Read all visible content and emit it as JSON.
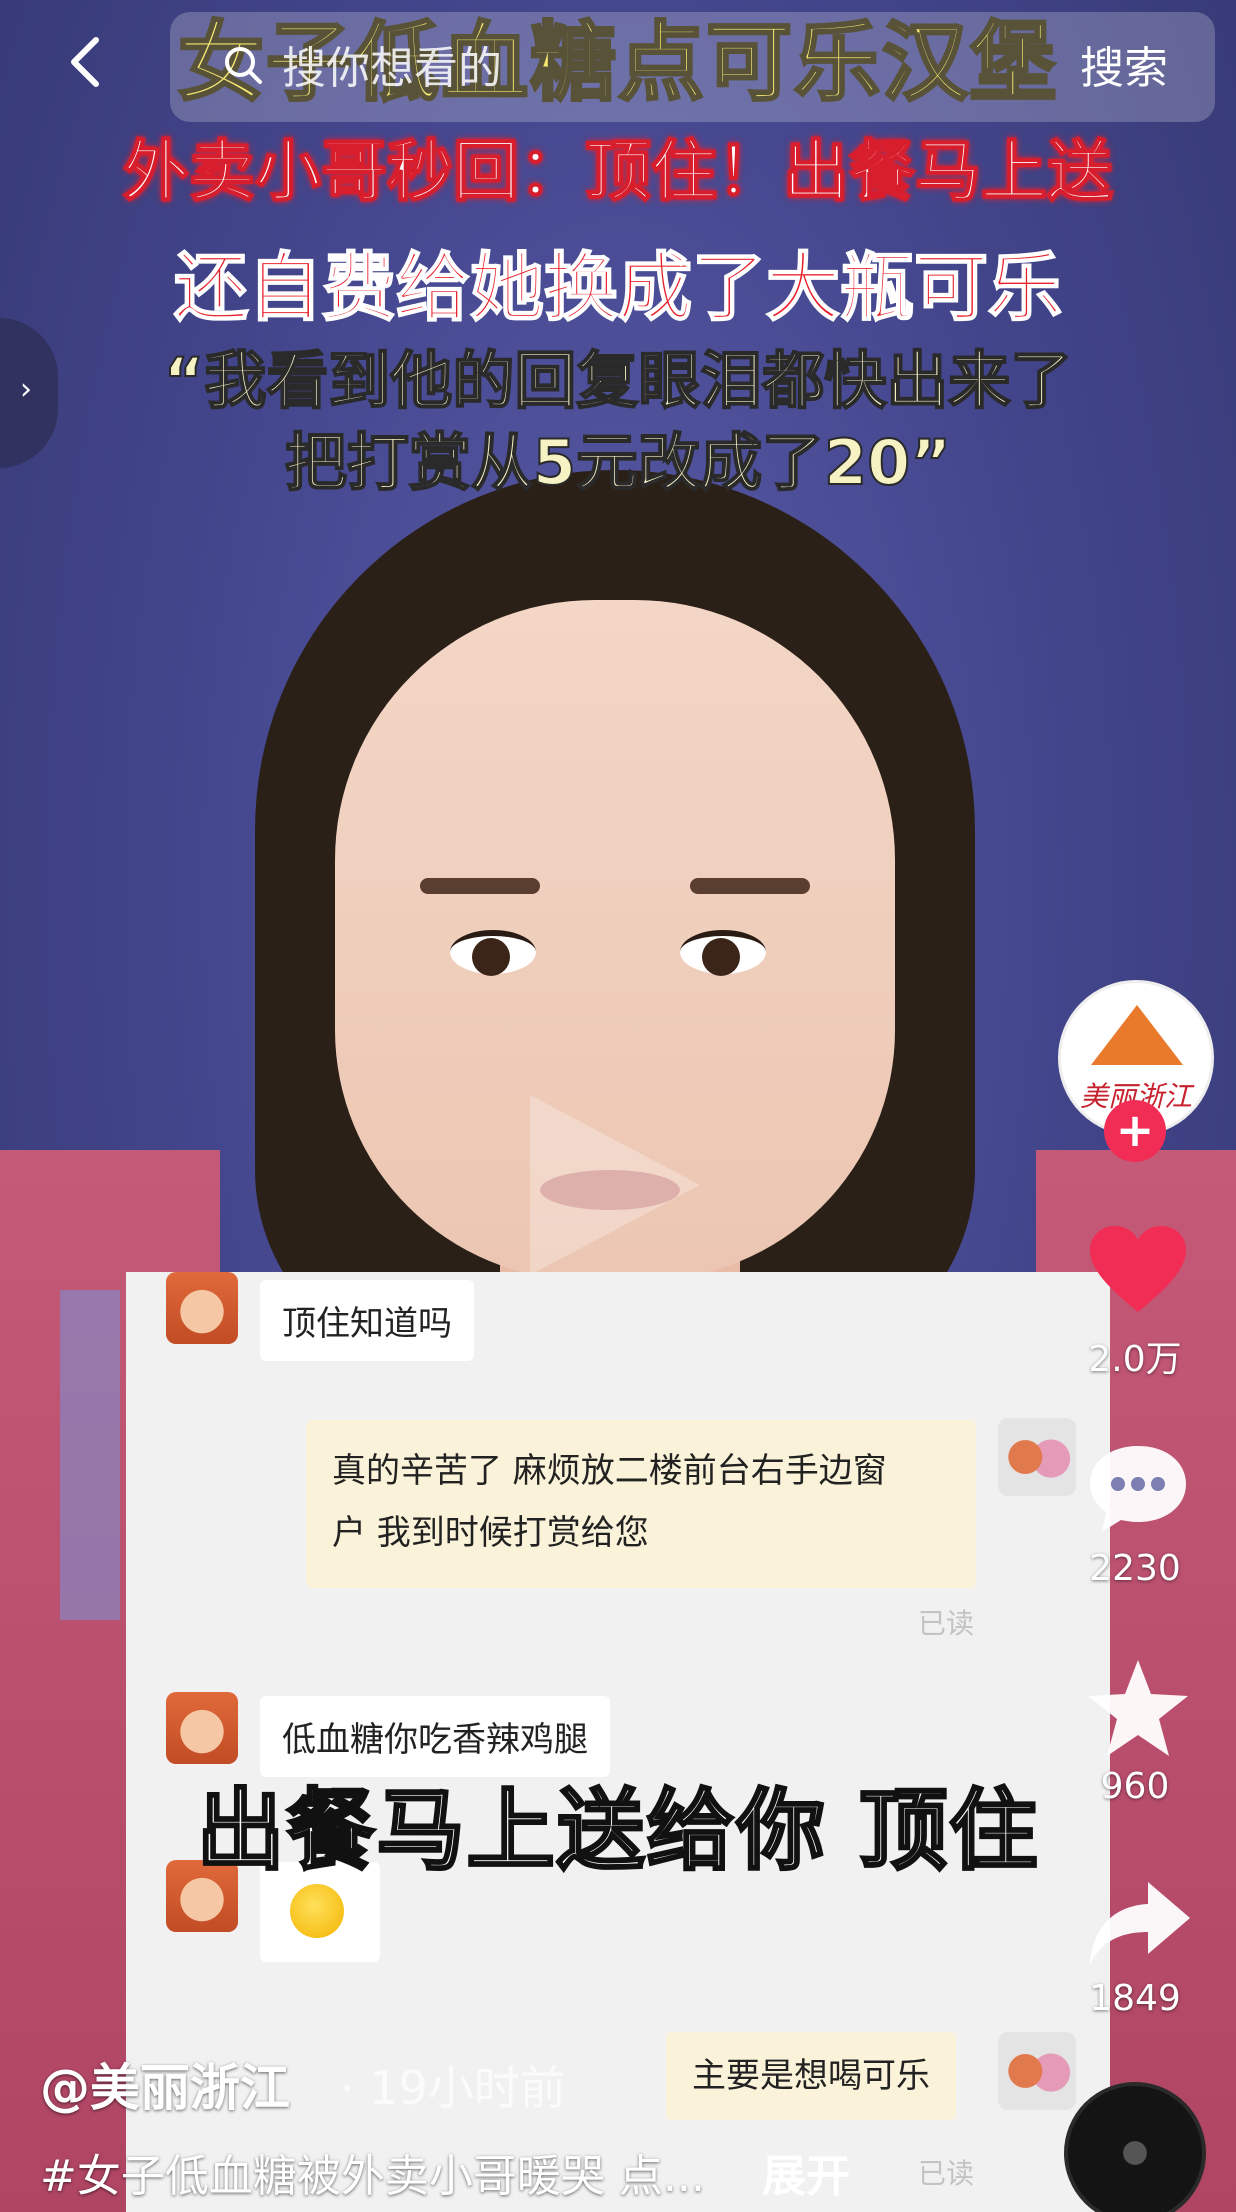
{
  "header": {
    "back_icon": "chevron-left-icon",
    "search_placeholder": "搜你想看的",
    "search_button": "搜索"
  },
  "video": {
    "headline_1": "女子低血糖点可乐汉堡",
    "headline_2": "外卖小哥秒回：顶住！出餐马上送",
    "headline_3": "还自费给她换成了大瓶可乐",
    "quote_line_1": "“我看到他的回复眼泪都快出来了",
    "quote_line_2": "把打赏从5元改成了20”",
    "subtitle": "出餐马上送给你 顶住"
  },
  "chat": {
    "msg1": "顶住知道吗",
    "msg2_line1": "真的辛苦了 麻烦放二楼前台右手边窗",
    "msg2_line2": "户 我到时候打赏给您",
    "read1": "已读",
    "msg3": "低血糖你吃香辣鸡腿",
    "msg5": "主要是想喝可乐",
    "read2": "已读"
  },
  "rail": {
    "account_logo_text": "美丽浙江",
    "follow_symbol": "+",
    "likes": "2.0万",
    "comments": "2230",
    "favorites": "960",
    "shares": "1849"
  },
  "meta": {
    "author": "@美丽浙江",
    "time": "· 19小时前",
    "description": "#女子低血糖被外卖小哥暖哭 点...",
    "expand": "展开"
  },
  "colors": {
    "like": "#f22d55",
    "follow": "#f22d55",
    "headline_yellow": "#f2e24a",
    "headline_red": "#e8202c"
  }
}
